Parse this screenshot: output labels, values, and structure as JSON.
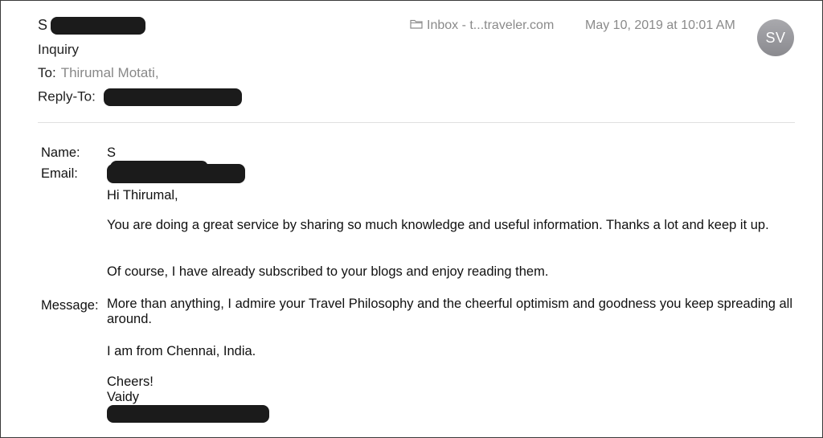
{
  "header": {
    "sender_initial": "S",
    "subject": "Inquiry",
    "to_label": "To:",
    "to_value": "Thirumal Motati,",
    "reply_to_label": "Reply-To:",
    "mailbox": "Inbox - t...traveler.com",
    "date": "May 10, 2019 at 10:01 AM",
    "avatar_initials": "SV"
  },
  "form": {
    "name_label": "Name:",
    "name_value": "S",
    "email_label": "Email:",
    "message_label": "Message:"
  },
  "message": {
    "greeting": "Hi Thirumal,",
    "p1": "You are doing a great service by sharing so much knowledge and useful information. Thanks a lot and keep it up.",
    "p2": "Of course, I have already subscribed to your blogs and enjoy reading them.",
    "p3": "More than anything, I admire your Travel Philosophy and the cheerful optimism and goodness you keep spreading all around.",
    "p4": "I am from Chennai, India.",
    "signoff": "Cheers!",
    "signature": "Vaidy"
  },
  "icons": {
    "mailbox": "folder-icon"
  },
  "colors": {
    "redaction": "#1b1b1b",
    "meta_text": "#8a8a8a",
    "avatar": "#9a9a9e"
  }
}
